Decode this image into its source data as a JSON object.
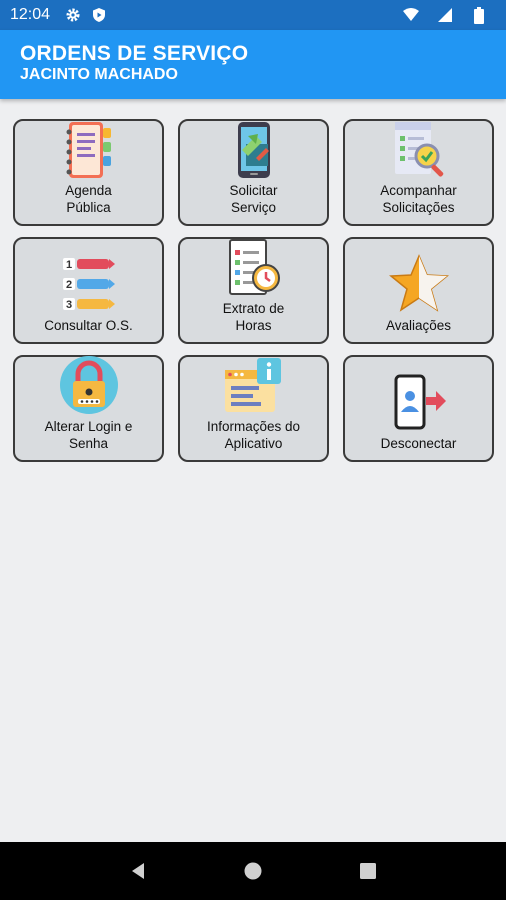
{
  "status_bar": {
    "time": "12:04",
    "left_icons": [
      "gear-icon",
      "shield-play-icon"
    ],
    "right_icons": [
      "wifi-icon",
      "signal-icon",
      "battery-icon"
    ]
  },
  "app_bar": {
    "title": "ORDENS DE SERVIÇO",
    "subtitle": "JACINTO MACHADO"
  },
  "menu": {
    "items": [
      {
        "label": "Agenda\nPública",
        "icon": "notebook-icon"
      },
      {
        "label": "Solicitar\nServiço",
        "icon": "phone-request-icon"
      },
      {
        "label": "Acompanhar\nSolicitações",
        "icon": "checklist-search-icon"
      },
      {
        "label": "Consultar O.S.",
        "icon": "numbered-list-icon"
      },
      {
        "label": "Extrato de\nHoras",
        "icon": "timesheet-icon"
      },
      {
        "label": "Avaliações",
        "icon": "star-icon"
      },
      {
        "label": "Alterar Login e\nSenha",
        "icon": "padlock-icon"
      },
      {
        "label": "Informações do\nAplicativo",
        "icon": "info-window-icon"
      },
      {
        "label": "Desconectar",
        "icon": "logout-icon"
      }
    ]
  },
  "colors": {
    "status_bar": "#1c6fc0",
    "app_bar": "#2196f3",
    "tile_background": "#d9dcdf",
    "page_background": "#eeeff1"
  },
  "nav_bar": {
    "icons": [
      "back-icon",
      "home-icon",
      "recents-icon"
    ]
  }
}
